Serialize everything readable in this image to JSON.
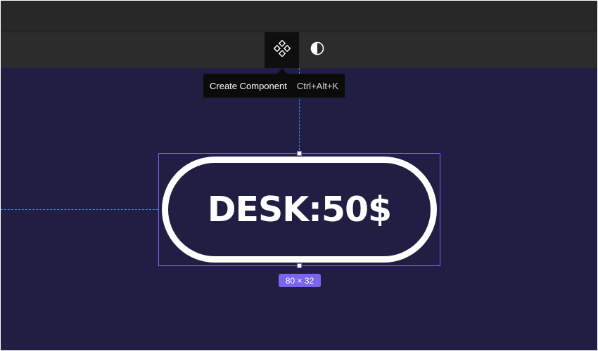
{
  "toolbar": {
    "create_component_icon": "component-icon",
    "contrast_icon": "contrast-icon"
  },
  "tooltip": {
    "label": "Create Component",
    "shortcut": "Ctrl+Alt+K"
  },
  "canvas": {
    "element_text": "DESK:50$",
    "size_label": "80 × 32"
  },
  "colors": {
    "canvas_bg": "#201e43",
    "selection": "#7b64f0",
    "guide": "#3e8de0"
  }
}
